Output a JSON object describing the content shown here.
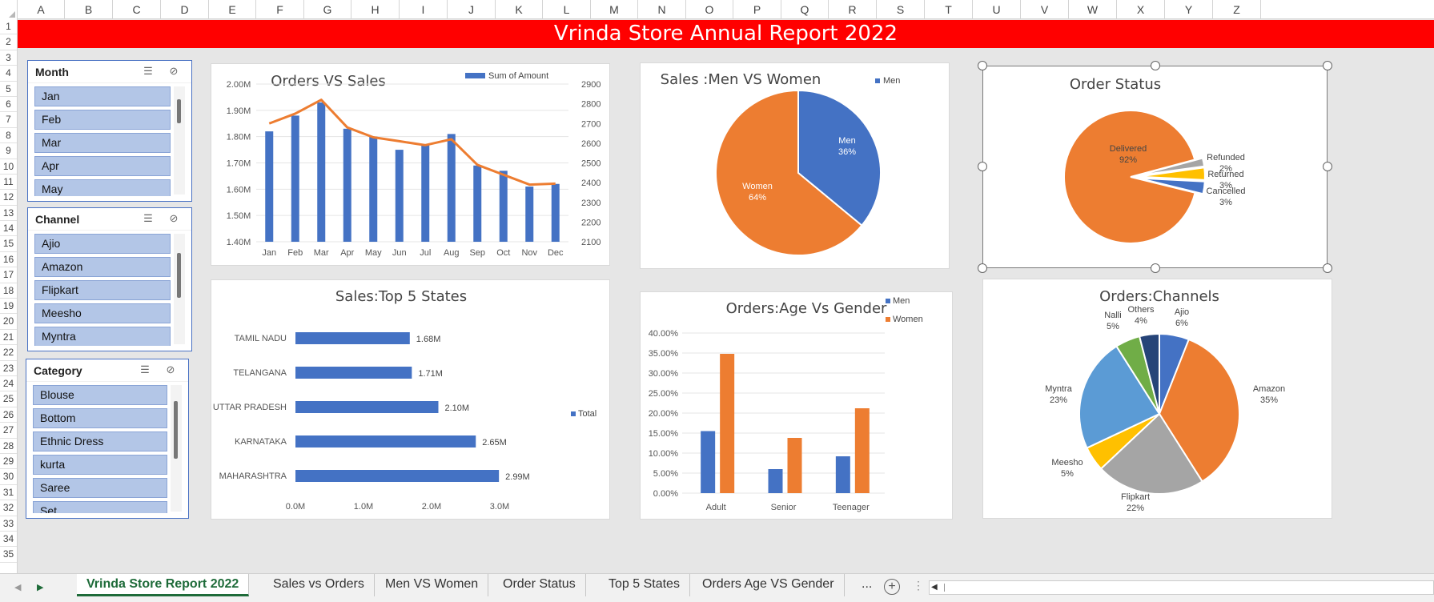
{
  "columns": [
    "A",
    "B",
    "C",
    "D",
    "E",
    "F",
    "G",
    "H",
    "I",
    "J",
    "K",
    "L",
    "M",
    "N",
    "O",
    "P",
    "Q",
    "R",
    "S",
    "T",
    "U",
    "V",
    "W",
    "X",
    "Y",
    "Z"
  ],
  "rows": [
    "1",
    "2",
    "3",
    "4",
    "5",
    "6",
    "7",
    "8",
    "9",
    "10",
    "11",
    "12",
    "13",
    "14",
    "15",
    "16",
    "17",
    "18",
    "19",
    "20",
    "21",
    "22",
    "23",
    "24",
    "25",
    "26",
    "27",
    "28",
    "29",
    "30",
    "31",
    "32",
    "33",
    "34",
    "35"
  ],
  "report_title": "Vrinda Store Annual Report 2022",
  "slicers": {
    "month": {
      "title": "Month",
      "items": [
        "Jan",
        "Feb",
        "Mar",
        "Apr",
        "May"
      ]
    },
    "channel": {
      "title": "Channel",
      "items": [
        "Ajio",
        "Amazon",
        "Flipkart",
        "Meesho",
        "Myntra"
      ]
    },
    "category": {
      "title": "Category",
      "items": [
        "Blouse",
        "Bottom",
        "Ethnic Dress",
        "kurta",
        "Saree",
        "Set"
      ]
    },
    "multiselect_icon": "multi-select-icon",
    "clear_icon": "clear-filter-icon"
  },
  "chart_data": [
    {
      "id": "orders_vs_sales",
      "type": "bar",
      "title": "Orders VS Sales",
      "categories": [
        "Jan",
        "Feb",
        "Mar",
        "Apr",
        "May",
        "Jun",
        "Jul",
        "Aug",
        "Sep",
        "Oct",
        "Nov",
        "Dec"
      ],
      "series": [
        {
          "name": "Sum of Amount",
          "type": "bar",
          "axis": "left",
          "values": [
            1.82,
            1.88,
            1.93,
            1.83,
            1.8,
            1.75,
            1.77,
            1.81,
            1.69,
            1.67,
            1.61,
            1.62
          ]
        },
        {
          "type": "line",
          "axis": "right",
          "values": [
            2700,
            2750,
            2820,
            2680,
            2630,
            2610,
            2590,
            2620,
            2490,
            2440,
            2390,
            2395
          ]
        }
      ],
      "y_left_ticks": [
        "1.40M",
        "1.50M",
        "1.60M",
        "1.70M",
        "1.80M",
        "1.90M",
        "2.00M"
      ],
      "y_left_range": [
        1.4,
        2.0
      ],
      "y_right_ticks": [
        "2100",
        "2200",
        "2300",
        "2400",
        "2500",
        "2600",
        "2700",
        "2800",
        "2900"
      ],
      "y_right_range": [
        2100,
        2900
      ],
      "colors": {
        "bar": "#4472c4",
        "line": "#ed7d31"
      },
      "legend": "top-right"
    },
    {
      "id": "men_vs_women",
      "type": "pie",
      "title": "Sales :Men VS Women",
      "slices": [
        {
          "name": "Men",
          "value": 36,
          "label": "Men",
          "pct": "36%",
          "color": "#4472c4"
        },
        {
          "name": "Women",
          "value": 64,
          "label": "Women",
          "pct": "64%",
          "color": "#ed7d31"
        }
      ],
      "legend": [
        "Men"
      ]
    },
    {
      "id": "order_status",
      "type": "pie",
      "title": "Order Status",
      "slices": [
        {
          "name": "Delivered",
          "value": 92,
          "label": "Delivered",
          "pct": "92%",
          "color": "#ed7d31"
        },
        {
          "name": "Refunded",
          "value": 2,
          "label": "Refunded",
          "pct": "2%",
          "color": "#a5a5a5"
        },
        {
          "name": "Returned",
          "value": 3,
          "label": "Returned",
          "pct": "3%",
          "color": "#ffc000"
        },
        {
          "name": "Cancelled",
          "value": 3,
          "label": "Cancelled",
          "pct": "3%",
          "color": "#4472c4"
        }
      ]
    },
    {
      "id": "top5_states",
      "type": "bar",
      "orientation": "horizontal",
      "title": "Sales:Top 5 States",
      "categories": [
        "TAMIL NADU",
        "TELANGANA",
        "UTTAR PRADESH",
        "KARNATAKA",
        "MAHARASHTRA"
      ],
      "values": [
        1.68,
        1.71,
        2.1,
        2.65,
        2.99
      ],
      "value_labels": [
        "1.68M",
        "1.71M",
        "2.10M",
        "2.65M",
        "2.99M"
      ],
      "x_ticks": [
        "0.0M",
        "1.0M",
        "2.0M",
        "3.0M"
      ],
      "x_range": [
        0,
        3.0
      ],
      "legend": [
        "Total"
      ],
      "color": "#4472c4"
    },
    {
      "id": "age_vs_gender",
      "type": "bar",
      "title": "Orders:Age Vs Gender",
      "categories": [
        "Adult",
        "Senior",
        "Teenager"
      ],
      "series": [
        {
          "name": "Men",
          "values": [
            15.5,
            6.0,
            9.2
          ],
          "color": "#4472c4"
        },
        {
          "name": "Women",
          "values": [
            34.8,
            13.8,
            21.2
          ],
          "color": "#ed7d31"
        }
      ],
      "y_ticks": [
        "0.00%",
        "5.00%",
        "10.00%",
        "15.00%",
        "20.00%",
        "25.00%",
        "30.00%",
        "35.00%",
        "40.00%"
      ],
      "y_range": [
        0,
        40
      ],
      "legend": "top-right"
    },
    {
      "id": "channels",
      "type": "pie",
      "title": "Orders:Channels",
      "slices": [
        {
          "name": "Ajio",
          "value": 6,
          "label": "Ajio",
          "pct": "6%",
          "color": "#4472c4"
        },
        {
          "name": "Amazon",
          "value": 35,
          "label": "Amazon",
          "pct": "35%",
          "color": "#ed7d31"
        },
        {
          "name": "Flipkart",
          "value": 22,
          "label": "Flipkart",
          "pct": "22%",
          "color": "#a5a5a5"
        },
        {
          "name": "Meesho",
          "value": 5,
          "label": "Meesho",
          "pct": "5%",
          "color": "#ffc000"
        },
        {
          "name": "Myntra",
          "value": 23,
          "label": "Myntra",
          "pct": "23%",
          "color": "#5b9bd5"
        },
        {
          "name": "Nalli",
          "value": 5,
          "label": "Nalli",
          "pct": "5%",
          "color": "#70ad47"
        },
        {
          "name": "Others",
          "value": 4,
          "label": "Others",
          "pct": "4%",
          "color": "#264478"
        }
      ]
    }
  ],
  "sheet_tabs": [
    "Vrinda Store Report 2022",
    "Sales vs Orders",
    "Men VS Women",
    "Order Status",
    "Top 5 States",
    "Orders Age VS Gender"
  ],
  "active_tab": "Vrinda Store Report 2022",
  "more_tabs": "...",
  "add_sheet": "+"
}
